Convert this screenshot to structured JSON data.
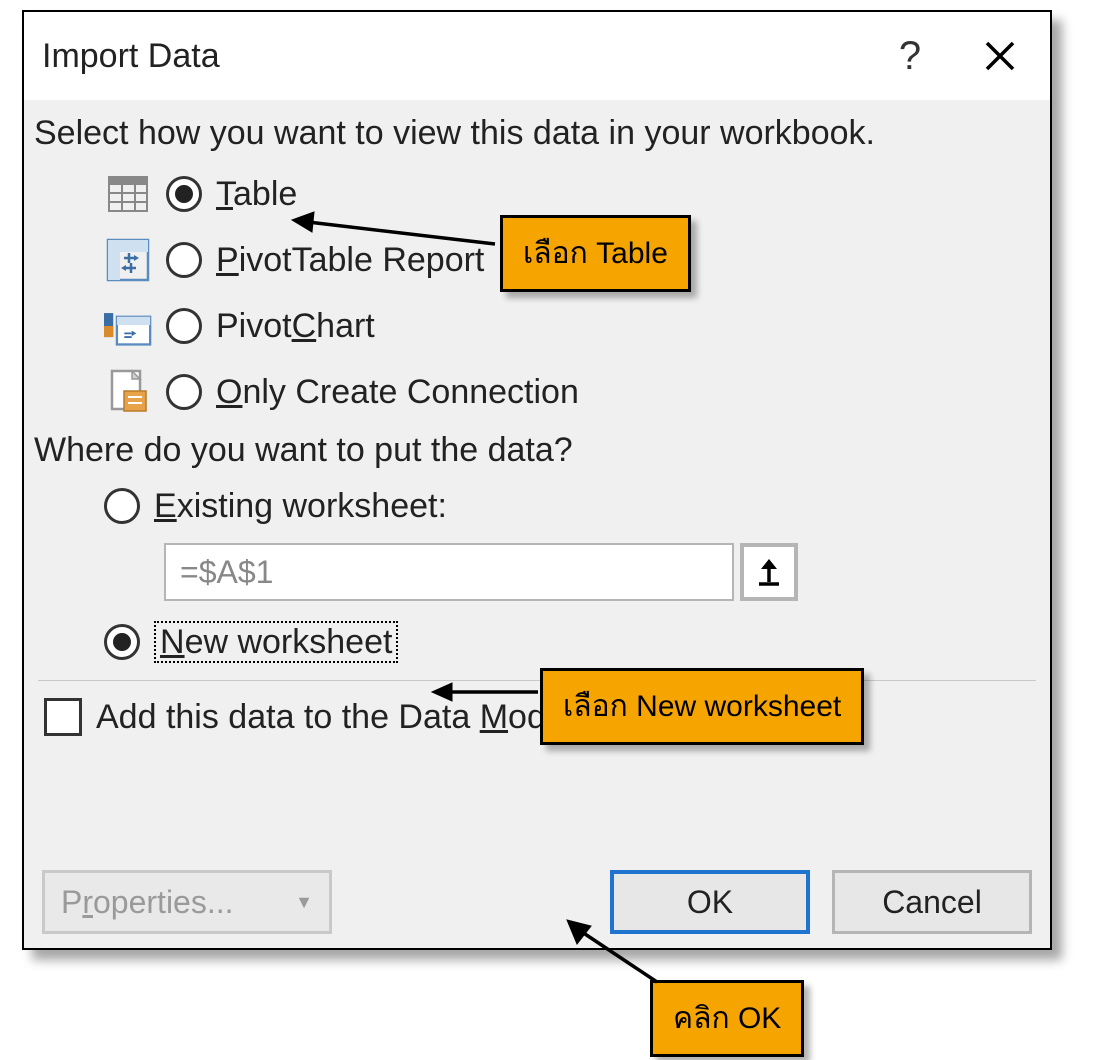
{
  "dialog": {
    "title": "Import Data",
    "help_symbol": "?",
    "section1_label": "Select how you want to view this data in your workbook.",
    "view_options": {
      "table": {
        "label_pre": "",
        "accel": "T",
        "label_post": "able",
        "checked": true,
        "icon": "table-icon"
      },
      "pivottable": {
        "label_pre": "",
        "accel": "P",
        "label_post": "ivotTable Report",
        "checked": false,
        "icon": "pivottable-icon"
      },
      "pivotchart": {
        "label_pre": "Pivot",
        "accel": "C",
        "label_post": "hart",
        "checked": false,
        "icon": "pivotchart-icon"
      },
      "connection": {
        "label_pre": "",
        "accel": "O",
        "label_post": "nly Create Connection",
        "checked": false,
        "icon": "connection-icon"
      }
    },
    "section2_label": "Where do you want to put the data?",
    "place_options": {
      "existing": {
        "label_pre": "",
        "accel": "E",
        "label_post": "xisting worksheet:",
        "checked": false
      },
      "cellref": "=$A$1",
      "new": {
        "label_pre": "",
        "accel": "N",
        "label_post": "ew worksheet",
        "checked": true
      }
    },
    "datamodel": {
      "label_pre": "Add this data to the Data ",
      "accel": "M",
      "label_post": "odel",
      "checked": false
    },
    "buttons": {
      "properties_pre": "P",
      "properties_accel": "r",
      "properties_post": "operties...",
      "ok": "OK",
      "cancel": "Cancel"
    }
  },
  "callouts": {
    "c1": "เลือก Table",
    "c2": "เลือก New worksheet",
    "c3": "คลิก OK"
  }
}
